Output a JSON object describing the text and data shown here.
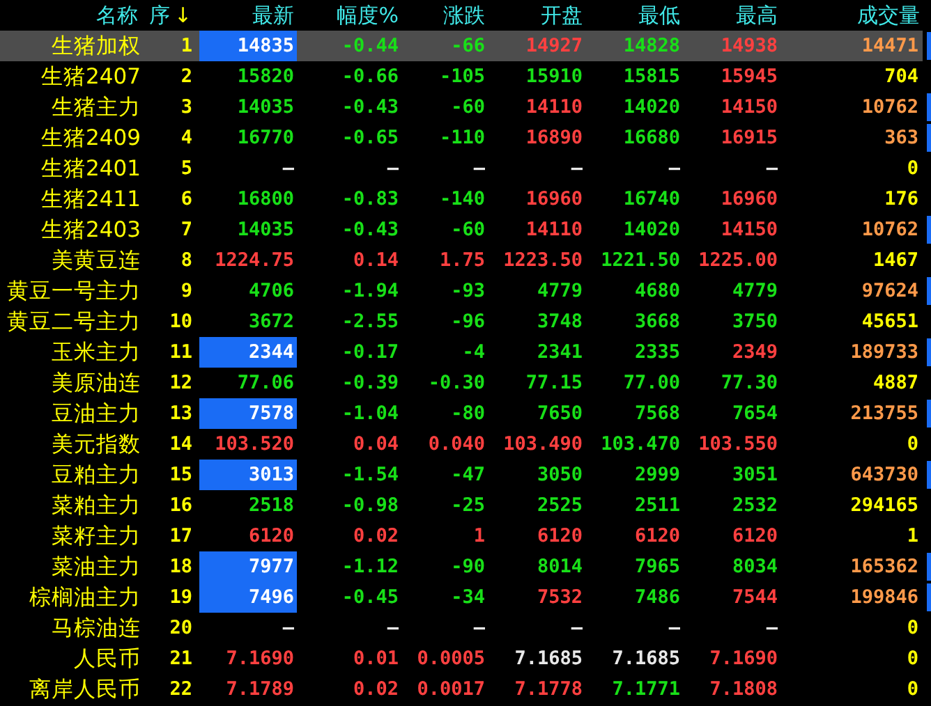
{
  "columns": [
    {
      "label": "名称"
    },
    {
      "label": "序",
      "sort": "↓"
    },
    {
      "label": "最新"
    },
    {
      "label": "幅度%"
    },
    {
      "label": "涨跌"
    },
    {
      "label": "开盘"
    },
    {
      "label": "最低"
    },
    {
      "label": "最高"
    },
    {
      "label": "成交量"
    }
  ],
  "rows": [
    {
      "name": "生猪加权",
      "seq": "1",
      "selected": true,
      "marker": true,
      "flash": true,
      "cells": [
        {
          "text": "14835",
          "color": "#ffffff"
        },
        {
          "text": "-0.44",
          "color": "#18e018"
        },
        {
          "text": "-66",
          "color": "#18e018"
        },
        {
          "text": "14927",
          "color": "#ff4040"
        },
        {
          "text": "14828",
          "color": "#18e018"
        },
        {
          "text": "14938",
          "color": "#ff4040"
        }
      ],
      "volume": {
        "text": "14471",
        "color": "#ff9a4a"
      }
    },
    {
      "name": "生猪2407",
      "seq": "2",
      "selected": false,
      "marker": false,
      "flash": false,
      "cells": [
        {
          "text": "15820",
          "color": "#18e018"
        },
        {
          "text": "-0.66",
          "color": "#18e018"
        },
        {
          "text": "-105",
          "color": "#18e018"
        },
        {
          "text": "15910",
          "color": "#18e018"
        },
        {
          "text": "15815",
          "color": "#18e018"
        },
        {
          "text": "15945",
          "color": "#ff4040"
        }
      ],
      "volume": {
        "text": "704",
        "color": "#ffff00"
      }
    },
    {
      "name": "生猪主力",
      "seq": "3",
      "selected": false,
      "marker": true,
      "flash": false,
      "cells": [
        {
          "text": "14035",
          "color": "#18e018"
        },
        {
          "text": "-0.43",
          "color": "#18e018"
        },
        {
          "text": "-60",
          "color": "#18e018"
        },
        {
          "text": "14110",
          "color": "#ff4040"
        },
        {
          "text": "14020",
          "color": "#18e018"
        },
        {
          "text": "14150",
          "color": "#ff4040"
        }
      ],
      "volume": {
        "text": "10762",
        "color": "#ff9a4a"
      }
    },
    {
      "name": "生猪2409",
      "seq": "4",
      "selected": false,
      "marker": true,
      "flash": false,
      "cells": [
        {
          "text": "16770",
          "color": "#18e018"
        },
        {
          "text": "-0.65",
          "color": "#18e018"
        },
        {
          "text": "-110",
          "color": "#18e018"
        },
        {
          "text": "16890",
          "color": "#ff4040"
        },
        {
          "text": "16680",
          "color": "#18e018"
        },
        {
          "text": "16915",
          "color": "#ff4040"
        }
      ],
      "volume": {
        "text": "363",
        "color": "#ff9a4a"
      }
    },
    {
      "name": "生猪2401",
      "seq": "5",
      "selected": false,
      "marker": false,
      "flash": false,
      "cells": [
        {
          "text": "—",
          "color": "#e8e8e8"
        },
        {
          "text": "—",
          "color": "#e8e8e8"
        },
        {
          "text": "—",
          "color": "#e8e8e8"
        },
        {
          "text": "—",
          "color": "#e8e8e8"
        },
        {
          "text": "—",
          "color": "#e8e8e8"
        },
        {
          "text": "—",
          "color": "#e8e8e8"
        }
      ],
      "volume": {
        "text": "0",
        "color": "#ffff00"
      }
    },
    {
      "name": "生猪2411",
      "seq": "6",
      "selected": false,
      "marker": false,
      "flash": false,
      "cells": [
        {
          "text": "16800",
          "color": "#18e018"
        },
        {
          "text": "-0.83",
          "color": "#18e018"
        },
        {
          "text": "-140",
          "color": "#18e018"
        },
        {
          "text": "16960",
          "color": "#ff4040"
        },
        {
          "text": "16740",
          "color": "#18e018"
        },
        {
          "text": "16960",
          "color": "#ff4040"
        }
      ],
      "volume": {
        "text": "176",
        "color": "#ffff00"
      }
    },
    {
      "name": "生猪2403",
      "seq": "7",
      "selected": false,
      "marker": true,
      "flash": false,
      "cells": [
        {
          "text": "14035",
          "color": "#18e018"
        },
        {
          "text": "-0.43",
          "color": "#18e018"
        },
        {
          "text": "-60",
          "color": "#18e018"
        },
        {
          "text": "14110",
          "color": "#ff4040"
        },
        {
          "text": "14020",
          "color": "#18e018"
        },
        {
          "text": "14150",
          "color": "#ff4040"
        }
      ],
      "volume": {
        "text": "10762",
        "color": "#ff9a4a"
      }
    },
    {
      "name": "美黄豆连",
      "seq": "8",
      "selected": false,
      "marker": false,
      "flash": false,
      "cells": [
        {
          "text": "1224.75",
          "color": "#ff4040"
        },
        {
          "text": "0.14",
          "color": "#ff4040"
        },
        {
          "text": "1.75",
          "color": "#ff4040"
        },
        {
          "text": "1223.50",
          "color": "#ff4040"
        },
        {
          "text": "1221.50",
          "color": "#18e018"
        },
        {
          "text": "1225.00",
          "color": "#ff4040"
        }
      ],
      "volume": {
        "text": "1467",
        "color": "#ffff00"
      }
    },
    {
      "name": "黄豆一号主力",
      "seq": "9",
      "selected": false,
      "marker": true,
      "flash": false,
      "cells": [
        {
          "text": "4706",
          "color": "#18e018"
        },
        {
          "text": "-1.94",
          "color": "#18e018"
        },
        {
          "text": "-93",
          "color": "#18e018"
        },
        {
          "text": "4779",
          "color": "#18e018"
        },
        {
          "text": "4680",
          "color": "#18e018"
        },
        {
          "text": "4779",
          "color": "#18e018"
        }
      ],
      "volume": {
        "text": "97624",
        "color": "#ff9a4a"
      }
    },
    {
      "name": "黄豆二号主力",
      "seq": "10",
      "selected": false,
      "marker": false,
      "flash": false,
      "cells": [
        {
          "text": "3672",
          "color": "#18e018"
        },
        {
          "text": "-2.55",
          "color": "#18e018"
        },
        {
          "text": "-96",
          "color": "#18e018"
        },
        {
          "text": "3748",
          "color": "#18e018"
        },
        {
          "text": "3668",
          "color": "#18e018"
        },
        {
          "text": "3750",
          "color": "#18e018"
        }
      ],
      "volume": {
        "text": "45651",
        "color": "#ffff00"
      }
    },
    {
      "name": "玉米主力",
      "seq": "11",
      "selected": false,
      "marker": true,
      "flash": true,
      "cells": [
        {
          "text": "2344",
          "color": "#ffffff"
        },
        {
          "text": "-0.17",
          "color": "#18e018"
        },
        {
          "text": "-4",
          "color": "#18e018"
        },
        {
          "text": "2341",
          "color": "#18e018"
        },
        {
          "text": "2335",
          "color": "#18e018"
        },
        {
          "text": "2349",
          "color": "#ff4040"
        }
      ],
      "volume": {
        "text": "189733",
        "color": "#ff9a4a"
      }
    },
    {
      "name": "美原油连",
      "seq": "12",
      "selected": false,
      "marker": false,
      "flash": false,
      "cells": [
        {
          "text": "77.06",
          "color": "#18e018"
        },
        {
          "text": "-0.39",
          "color": "#18e018"
        },
        {
          "text": "-0.30",
          "color": "#18e018"
        },
        {
          "text": "77.15",
          "color": "#18e018"
        },
        {
          "text": "77.00",
          "color": "#18e018"
        },
        {
          "text": "77.30",
          "color": "#18e018"
        }
      ],
      "volume": {
        "text": "4887",
        "color": "#ffff00"
      }
    },
    {
      "name": "豆油主力",
      "seq": "13",
      "selected": false,
      "marker": true,
      "flash": true,
      "cells": [
        {
          "text": "7578",
          "color": "#ffffff"
        },
        {
          "text": "-1.04",
          "color": "#18e018"
        },
        {
          "text": "-80",
          "color": "#18e018"
        },
        {
          "text": "7650",
          "color": "#18e018"
        },
        {
          "text": "7568",
          "color": "#18e018"
        },
        {
          "text": "7654",
          "color": "#18e018"
        }
      ],
      "volume": {
        "text": "213755",
        "color": "#ff9a4a"
      }
    },
    {
      "name": "美元指数",
      "seq": "14",
      "selected": false,
      "marker": false,
      "flash": false,
      "cells": [
        {
          "text": "103.520",
          "color": "#ff4040"
        },
        {
          "text": "0.04",
          "color": "#ff4040"
        },
        {
          "text": "0.040",
          "color": "#ff4040"
        },
        {
          "text": "103.490",
          "color": "#ff4040"
        },
        {
          "text": "103.470",
          "color": "#18e018"
        },
        {
          "text": "103.550",
          "color": "#ff4040"
        }
      ],
      "volume": {
        "text": "0",
        "color": "#ffff00"
      }
    },
    {
      "name": "豆粕主力",
      "seq": "15",
      "selected": false,
      "marker": true,
      "flash": true,
      "cells": [
        {
          "text": "3013",
          "color": "#ffffff"
        },
        {
          "text": "-1.54",
          "color": "#18e018"
        },
        {
          "text": "-47",
          "color": "#18e018"
        },
        {
          "text": "3050",
          "color": "#18e018"
        },
        {
          "text": "2999",
          "color": "#18e018"
        },
        {
          "text": "3051",
          "color": "#18e018"
        }
      ],
      "volume": {
        "text": "643730",
        "color": "#ff9a4a"
      }
    },
    {
      "name": "菜粕主力",
      "seq": "16",
      "selected": false,
      "marker": false,
      "flash": false,
      "cells": [
        {
          "text": "2518",
          "color": "#18e018"
        },
        {
          "text": "-0.98",
          "color": "#18e018"
        },
        {
          "text": "-25",
          "color": "#18e018"
        },
        {
          "text": "2525",
          "color": "#18e018"
        },
        {
          "text": "2511",
          "color": "#18e018"
        },
        {
          "text": "2532",
          "color": "#18e018"
        }
      ],
      "volume": {
        "text": "294165",
        "color": "#ffff00"
      }
    },
    {
      "name": "菜籽主力",
      "seq": "17",
      "selected": false,
      "marker": false,
      "flash": false,
      "cells": [
        {
          "text": "6120",
          "color": "#ff4040"
        },
        {
          "text": "0.02",
          "color": "#ff4040"
        },
        {
          "text": "1",
          "color": "#ff4040"
        },
        {
          "text": "6120",
          "color": "#ff4040"
        },
        {
          "text": "6120",
          "color": "#ff4040"
        },
        {
          "text": "6120",
          "color": "#ff4040"
        }
      ],
      "volume": {
        "text": "1",
        "color": "#ffff00"
      }
    },
    {
      "name": "菜油主力",
      "seq": "18",
      "selected": false,
      "marker": true,
      "flash": true,
      "cells": [
        {
          "text": "7977",
          "color": "#ffffff"
        },
        {
          "text": "-1.12",
          "color": "#18e018"
        },
        {
          "text": "-90",
          "color": "#18e018"
        },
        {
          "text": "8014",
          "color": "#18e018"
        },
        {
          "text": "7965",
          "color": "#18e018"
        },
        {
          "text": "8034",
          "color": "#18e018"
        }
      ],
      "volume": {
        "text": "165362",
        "color": "#ff9a4a"
      }
    },
    {
      "name": "棕榈油主力",
      "seq": "19",
      "selected": false,
      "marker": true,
      "flash": true,
      "cells": [
        {
          "text": "7496",
          "color": "#ffffff"
        },
        {
          "text": "-0.45",
          "color": "#18e018"
        },
        {
          "text": "-34",
          "color": "#18e018"
        },
        {
          "text": "7532",
          "color": "#ff4040"
        },
        {
          "text": "7486",
          "color": "#18e018"
        },
        {
          "text": "7544",
          "color": "#ff4040"
        }
      ],
      "volume": {
        "text": "199846",
        "color": "#ff9a4a"
      }
    },
    {
      "name": "马棕油连",
      "seq": "20",
      "selected": false,
      "marker": false,
      "flash": false,
      "cells": [
        {
          "text": "—",
          "color": "#e8e8e8"
        },
        {
          "text": "—",
          "color": "#e8e8e8"
        },
        {
          "text": "—",
          "color": "#e8e8e8"
        },
        {
          "text": "—",
          "color": "#e8e8e8"
        },
        {
          "text": "—",
          "color": "#e8e8e8"
        },
        {
          "text": "—",
          "color": "#e8e8e8"
        }
      ],
      "volume": {
        "text": "0",
        "color": "#ffff00"
      }
    },
    {
      "name": "人民币",
      "seq": "21",
      "selected": false,
      "marker": false,
      "flash": false,
      "cells": [
        {
          "text": "7.1690",
          "color": "#ff4040"
        },
        {
          "text": "0.01",
          "color": "#ff4040"
        },
        {
          "text": "0.0005",
          "color": "#ff4040"
        },
        {
          "text": "7.1685",
          "color": "#e8e8e8"
        },
        {
          "text": "7.1685",
          "color": "#e8e8e8"
        },
        {
          "text": "7.1690",
          "color": "#ff4040"
        }
      ],
      "volume": {
        "text": "0",
        "color": "#ffff00"
      }
    },
    {
      "name": "离岸人民币",
      "seq": "22",
      "selected": false,
      "marker": false,
      "flash": false,
      "cells": [
        {
          "text": "7.1789",
          "color": "#ff4040"
        },
        {
          "text": "0.02",
          "color": "#ff4040"
        },
        {
          "text": "0.0017",
          "color": "#ff4040"
        },
        {
          "text": "7.1778",
          "color": "#ff4040"
        },
        {
          "text": "7.1771",
          "color": "#18e018"
        },
        {
          "text": "7.1808",
          "color": "#ff4040"
        }
      ],
      "volume": {
        "text": "0",
        "color": "#ffff00"
      }
    }
  ]
}
